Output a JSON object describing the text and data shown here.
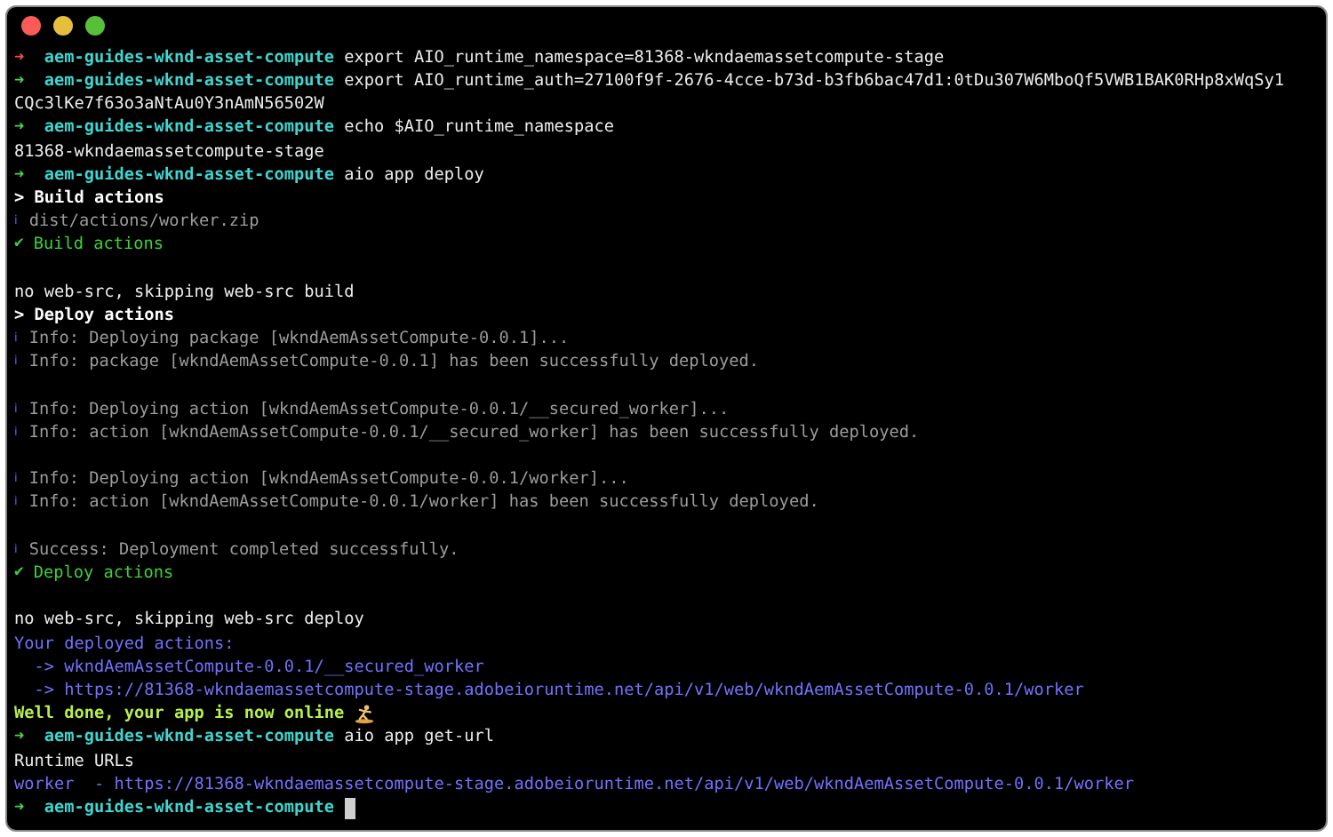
{
  "lines": [
    {
      "kind": "prompt",
      "failed": true,
      "arrow": "➜",
      "dir": "aem-guides-wknd-asset-compute",
      "command": "export AIO_runtime_namespace=81368-wkndaemassetcompute-stage"
    },
    {
      "kind": "prompt",
      "failed": false,
      "arrow": "➜",
      "dir": "aem-guides-wknd-asset-compute",
      "command": "export AIO_runtime_auth=27100f9f-2676-4cce-b73d-b3fb6bac47d1:0tDu307W6MboQf5VWB1BAK0RHp8xWqSy1"
    },
    {
      "kind": "plain",
      "text": "CQc3lKe7f63o3aNtAu0Y3nAmN56502W"
    },
    {
      "kind": "prompt",
      "failed": false,
      "arrow": "➜",
      "dir": "aem-guides-wknd-asset-compute",
      "command": "echo $AIO_runtime_namespace"
    },
    {
      "kind": "plain",
      "text": "81368-wkndaemassetcompute-stage"
    },
    {
      "kind": "prompt",
      "failed": false,
      "arrow": "➜",
      "dir": "aem-guides-wknd-asset-compute",
      "command": "aio app deploy"
    },
    {
      "kind": "heading",
      "text": "> Build actions"
    },
    {
      "kind": "info",
      "icon": "ℹ",
      "text": "dist/actions/worker.zip"
    },
    {
      "kind": "done",
      "icon": "✔",
      "text": "Build actions"
    },
    {
      "kind": "blank"
    },
    {
      "kind": "plain",
      "text": "no web-src, skipping web-src build"
    },
    {
      "kind": "heading",
      "text": "> Deploy actions"
    },
    {
      "kind": "info",
      "icon": "ℹ",
      "text": "Info: Deploying package [wkndAemAssetCompute-0.0.1]..."
    },
    {
      "kind": "info",
      "icon": "ℹ",
      "text": "Info: package [wkndAemAssetCompute-0.0.1] has been successfully deployed."
    },
    {
      "kind": "blank"
    },
    {
      "kind": "info",
      "icon": "ℹ",
      "text": "Info: Deploying action [wkndAemAssetCompute-0.0.1/__secured_worker]..."
    },
    {
      "kind": "info",
      "icon": "ℹ",
      "text": "Info: action [wkndAemAssetCompute-0.0.1/__secured_worker] has been successfully deployed."
    },
    {
      "kind": "blank"
    },
    {
      "kind": "info",
      "icon": "ℹ",
      "text": "Info: Deploying action [wkndAemAssetCompute-0.0.1/worker]..."
    },
    {
      "kind": "info",
      "icon": "ℹ",
      "text": "Info: action [wkndAemAssetCompute-0.0.1/worker] has been successfully deployed."
    },
    {
      "kind": "blank"
    },
    {
      "kind": "info",
      "icon": "ℹ",
      "text": "Success: Deployment completed successfully."
    },
    {
      "kind": "done",
      "icon": "✔",
      "text": "Deploy actions"
    },
    {
      "kind": "blank"
    },
    {
      "kind": "plain",
      "text": "no web-src, skipping web-src deploy"
    },
    {
      "kind": "highlight",
      "text": "Your deployed actions:"
    },
    {
      "kind": "highlight",
      "text": "  -> wkndAemAssetCompute-0.0.1/__secured_worker"
    },
    {
      "kind": "highlight",
      "text": "  -> https://81368-wkndaemassetcompute-stage.adobeioruntime.net/api/v1/web/wkndAemAssetCompute-0.0.1/worker"
    },
    {
      "kind": "celebrate",
      "text": "Well done, your app is now online"
    },
    {
      "kind": "prompt",
      "failed": false,
      "arrow": "➜",
      "dir": "aem-guides-wknd-asset-compute",
      "command": "aio app get-url"
    },
    {
      "kind": "plain",
      "text": "Runtime URLs"
    },
    {
      "kind": "highlight",
      "text": "worker  - https://81368-wkndaemassetcompute-stage.adobeioruntime.net/api/v1/web/wkndAemAssetCompute-0.0.1/worker"
    },
    {
      "kind": "prompt",
      "failed": false,
      "arrow": "➜",
      "dir": "aem-guides-wknd-asset-compute",
      "cursor": true
    }
  ]
}
